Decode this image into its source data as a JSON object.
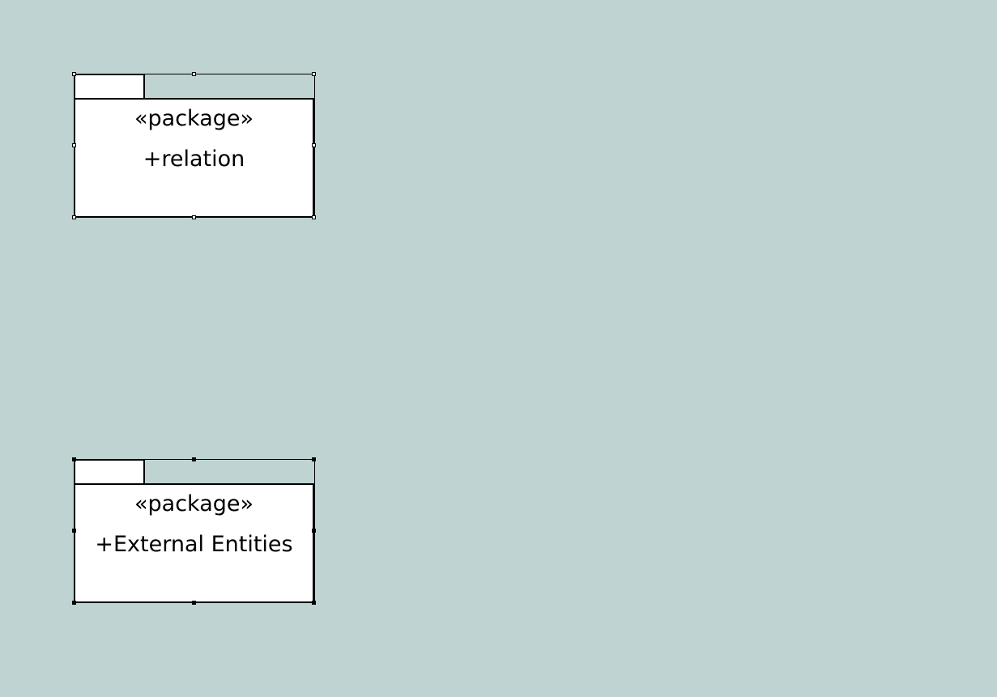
{
  "diagram": {
    "background_color": "#BED3D2",
    "packages": [
      {
        "stereotype": "«package»",
        "name": "+relation",
        "selected": true
      },
      {
        "stereotype": "«package»",
        "name": "+External Entities",
        "selected": true
      }
    ]
  }
}
